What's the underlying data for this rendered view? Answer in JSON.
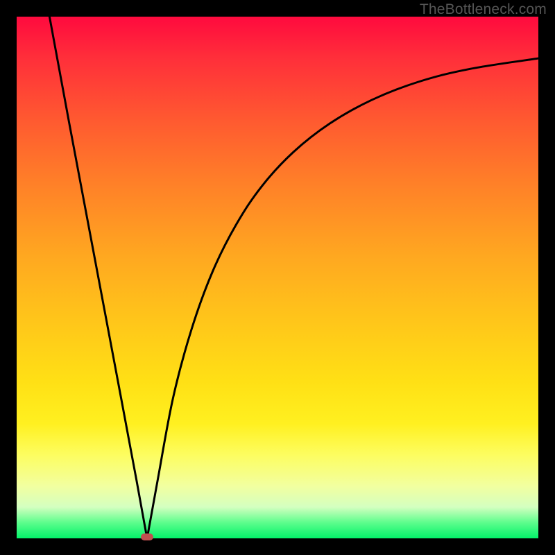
{
  "watermark": "TheBottleneck.com",
  "colors": {
    "frame": "#000000",
    "curve": "#000000",
    "marker": "#c05050"
  },
  "chart_data": {
    "type": "line",
    "title": "",
    "xlabel": "",
    "ylabel": "",
    "xlim": [
      0,
      100
    ],
    "ylim": [
      0,
      100
    ],
    "grid": false,
    "legend": false,
    "min_point": {
      "x": 25,
      "y": 0
    },
    "series": [
      {
        "name": "left-branch",
        "x": [
          6.3,
          10,
          15,
          20,
          23,
          25
        ],
        "y": [
          100,
          80,
          53.5,
          27,
          11,
          0
        ]
      },
      {
        "name": "right-branch",
        "x": [
          25,
          27,
          30,
          33.5,
          37.5,
          42,
          47,
          53,
          60,
          68,
          77,
          87,
          100
        ],
        "y": [
          0,
          11,
          27,
          40,
          51,
          60,
          67.5,
          74,
          79.5,
          84,
          87.5,
          90,
          92
        ]
      }
    ],
    "annotations": [
      {
        "text": "TheBottleneck.com",
        "position": "top-right"
      }
    ]
  }
}
